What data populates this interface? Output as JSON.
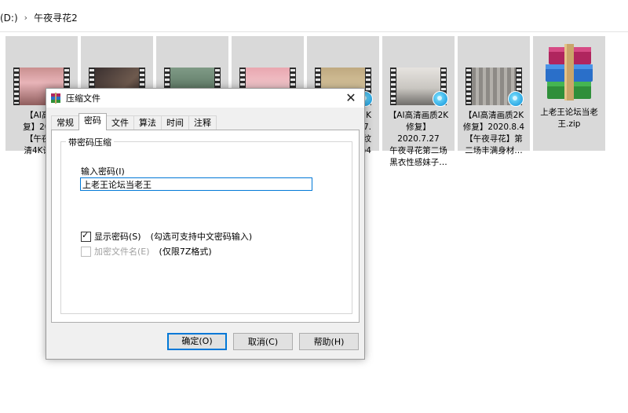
{
  "explorer": {
    "drive": "(D:)",
    "folder": "午夜寻花2"
  },
  "files": [
    {
      "label": "【AI高清画质2K修复】2020…【午夜寻花…清4K设备…",
      "lines": [
        "【AI高清",
        "复】2020",
        "【午夜寻",
        "清4K设备"
      ]
    },
    {
      "label": "",
      "lines": []
    },
    {
      "label": "",
      "lines": []
    },
    {
      "label": "",
      "lines": []
    },
    {
      "lines": [
        "2K",
        "7.",
        "纹",
        "p4"
      ]
    },
    {
      "lines": [
        "【AI高清画质2K",
        "修复】2020.7.27",
        "午夜寻花第二场",
        "黑衣性感妹子…"
      ]
    },
    {
      "lines": [
        "【AI高清画质2K",
        "修复】2020.8.4",
        "【午夜寻花】第",
        "二场丰满身材…"
      ]
    },
    {
      "lines": [
        "上老王论坛当老",
        "王.zip"
      ]
    }
  ],
  "dialog": {
    "title": "压缩文件",
    "close": "✕",
    "tabs": [
      "常规",
      "密码",
      "文件",
      "算法",
      "时间",
      "注释"
    ],
    "active_tab": "密码",
    "group_title": "带密码压缩",
    "password_label": "输入密码(I)",
    "password_value": "上老王论坛当老王",
    "show_password": {
      "label": "显示密码(S)",
      "note": "(勾选可支持中文密码输入)",
      "checked": true
    },
    "encrypt_names": {
      "label": "加密文件名(E)",
      "note": "(仅限7Z格式)",
      "checked": false,
      "enabled": false
    },
    "buttons": {
      "ok": "确定(O)",
      "cancel": "取消(C)",
      "help": "帮助(H)"
    }
  },
  "colors": {
    "accent": "#0078d7",
    "tile_bg": "#d9d9d9",
    "dialog_bg": "#f0f0f0"
  }
}
